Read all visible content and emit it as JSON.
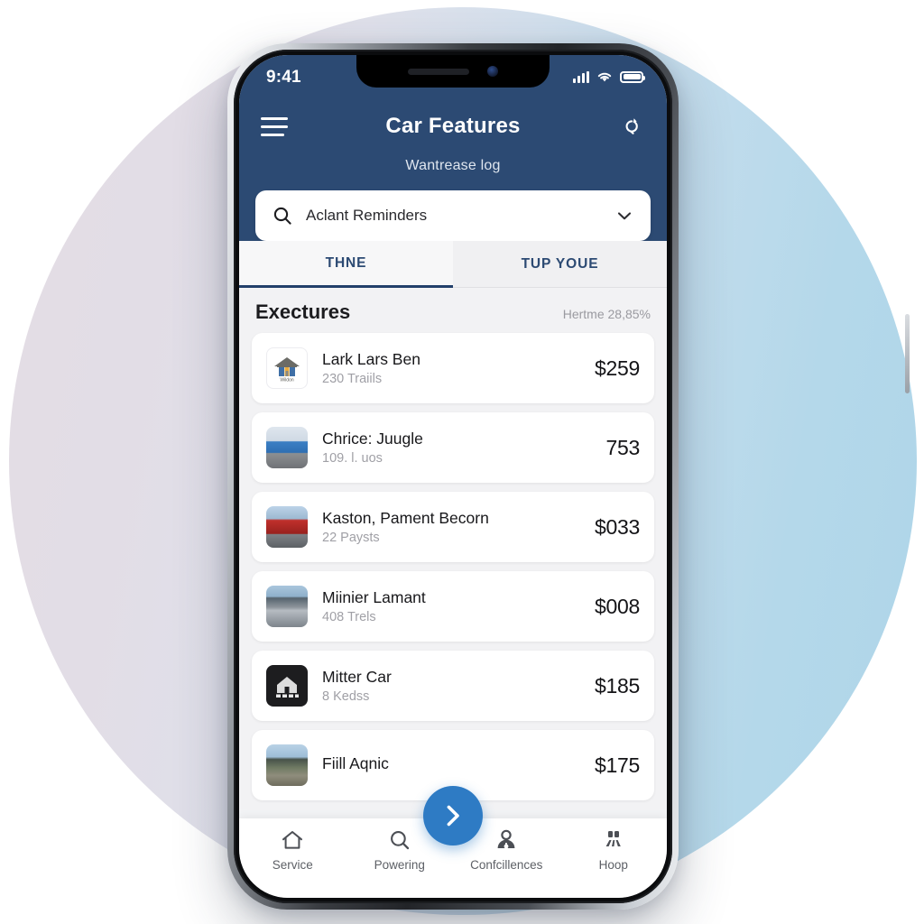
{
  "status_bar": {
    "time": "9:41",
    "signal_icon": "cellular-bars-icon",
    "wifi_icon": "wifi-icon",
    "battery_icon": "battery-icon"
  },
  "header": {
    "menu_icon": "hamburger-menu-icon",
    "title": "Car Features",
    "action_icon": "bell-refresh-icon",
    "subtitle": "Wantrease log",
    "background_color": "#2c4a73"
  },
  "search": {
    "icon": "search-icon",
    "value": "Aclant Reminders",
    "placeholder": "Aclant Reminders",
    "chevron_icon": "chevron-down-icon"
  },
  "tabs": [
    {
      "label": "THNE",
      "active": true
    },
    {
      "label": "TUP YOUE",
      "active": false
    }
  ],
  "section": {
    "title": "Exectures",
    "meta": "Hertme 28,85%"
  },
  "list": [
    {
      "thumb": "home-logo-thumb",
      "thumb_caption": "Wildon",
      "title": "Lark Lars Ben",
      "subtitle": "230 Traiils",
      "amount": "$259"
    },
    {
      "thumb": "blue-car-thumb",
      "thumb_caption": "",
      "title": "Chrice: Juugle",
      "subtitle": "109. l. uos",
      "amount": "753"
    },
    {
      "thumb": "red-car-thumb",
      "thumb_caption": "",
      "title": "Kaston, Pament Becorn",
      "subtitle": "22 Paysts",
      "amount": "$033"
    },
    {
      "thumb": "street-cars-thumb",
      "thumb_caption": "",
      "title": "Miinier Lamant",
      "subtitle": "408 Trels",
      "amount": "$008"
    },
    {
      "thumb": "dark-barn-thumb",
      "thumb_caption": "",
      "title": "Mitter Car",
      "subtitle": "8 Kedss",
      "amount": "$185"
    },
    {
      "thumb": "landscape-thumb",
      "thumb_caption": "",
      "title": "Fiill Aqnic",
      "subtitle": "",
      "amount": "$175"
    }
  ],
  "bottom_nav": {
    "items": [
      {
        "label": "Service",
        "icon": "home-icon"
      },
      {
        "label": "Powering",
        "icon": "search-icon"
      },
      {
        "label": "Confcillences",
        "icon": "person-icon"
      },
      {
        "label": "Hoop",
        "icon": "sparkle-icon"
      }
    ],
    "fab": {
      "icon": "chevron-right-icon",
      "color": "#2e7bc4"
    }
  },
  "theme": {
    "accent": "#2e7bc4",
    "header": "#2c4a73",
    "page_bg": "#f2f2f4",
    "backdrop_left": "#e4dde4",
    "backdrop_right": "#b4d8ea"
  }
}
